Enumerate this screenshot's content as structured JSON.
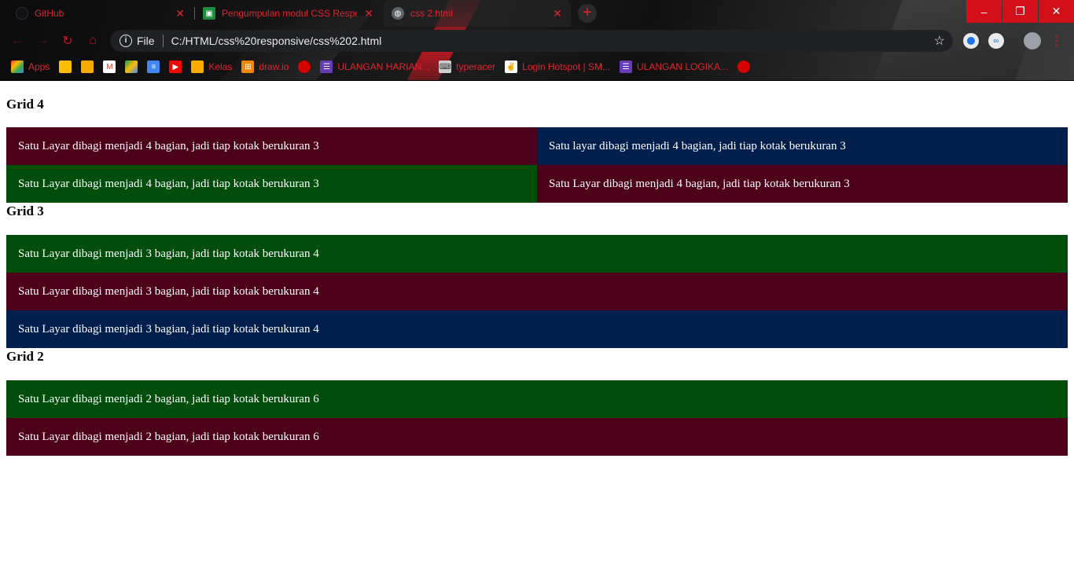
{
  "tabs": [
    {
      "title": "GitHub",
      "favicon": "github-icon"
    },
    {
      "title": "Pengumpulan modul CSS Respon",
      "favicon": "classroom-icon"
    },
    {
      "title": "css 2.html",
      "favicon": "globe-icon"
    }
  ],
  "window_controls": {
    "minimize": "–",
    "restore": "❐",
    "close": "✕"
  },
  "address_bar": {
    "scheme_label": "File",
    "url": "C:/HTML/css%20responsive/css%202.html"
  },
  "bookmarks": [
    {
      "label": "Apps",
      "icon": "apps-grid-icon"
    },
    {
      "label": "",
      "icon": "keep-icon"
    },
    {
      "label": "",
      "icon": "classroom-icon"
    },
    {
      "label": "",
      "icon": "gmail-icon"
    },
    {
      "label": "",
      "icon": "drive-icon"
    },
    {
      "label": "",
      "icon": "docs-icon"
    },
    {
      "label": "",
      "icon": "youtube-icon"
    },
    {
      "label": "Kelas",
      "icon": "classroom-icon"
    },
    {
      "label": "draw.io",
      "icon": "drawio-icon"
    },
    {
      "label": "",
      "icon": "globe-red-icon"
    },
    {
      "label": "ULANGAN HARIAN...",
      "icon": "forms-icon"
    },
    {
      "label": "typeracer",
      "icon": "typeracer-icon"
    },
    {
      "label": "Login Hotspot | SM...",
      "icon": "hotspot-icon"
    },
    {
      "label": "ULANGAN LOGIKA...",
      "icon": "forms-icon"
    },
    {
      "label": "",
      "icon": "globe-red-icon"
    }
  ],
  "colors": {
    "maroon": "#4d0019",
    "navy": "#001f4d",
    "green": "#004d0c",
    "accent_red": "#e0252f"
  },
  "content": {
    "grid4": {
      "heading": "Grid 4",
      "boxes": [
        "Satu Layar dibagi menjadi 4 bagian, jadi tiap kotak berukuran 3",
        "Satu layar dibagi menjadi 4 bagian, jadi tiap kotak berukuran 3",
        "Satu Layar dibagi menjadi 4 bagian, jadi tiap kotak berukuran 3",
        "Satu Layar dibagi menjadi 4 bagian, jadi tiap kotak berukuran 3"
      ]
    },
    "grid3": {
      "heading": "Grid 3",
      "boxes": [
        "Satu Layar dibagi menjadi 3 bagian, jadi tiap kotak berukuran 4",
        "Satu Layar dibagi menjadi 3 bagian, jadi tiap kotak berukuran 4",
        "Satu Layar dibagi menjadi 3 bagian, jadi tiap kotak berukuran 4"
      ]
    },
    "grid2": {
      "heading": "Grid 2",
      "boxes": [
        "Satu Layar dibagi menjadi 2 bagian, jadi tiap kotak berukuran 6",
        "Satu Layar dibagi menjadi 2 bagian, jadi tiap kotak berukuran 6"
      ]
    }
  }
}
